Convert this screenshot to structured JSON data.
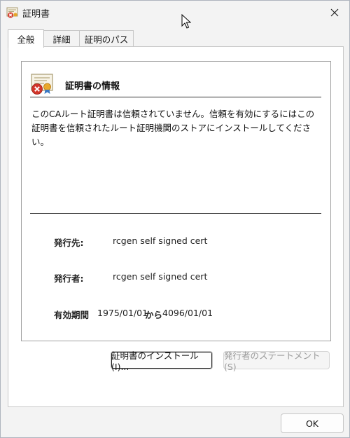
{
  "window": {
    "title": "証明書"
  },
  "tabs": [
    {
      "label": "全般"
    },
    {
      "label": "詳細"
    },
    {
      "label": "証明のパス"
    }
  ],
  "panel": {
    "heading": "証明書の情報",
    "message": "このCAルート証明書は信頼されていません。信頼を有効にするにはこの証明書を信頼されたルート証明機関のストアにインストールしてください。",
    "issued_to_label": "発行先:",
    "issued_to_value": "rcgen self signed cert",
    "issued_by_label": "発行者:",
    "issued_by_value": "rcgen self signed cert",
    "validity_label": "有効期間",
    "valid_from": "1975/01/01",
    "valid_sep": "から",
    "valid_to": "4096/01/01"
  },
  "buttons": {
    "install": "証明書のインストール(I)...",
    "issuer_statement": "発行者のステートメント(S)",
    "ok": "OK"
  },
  "icons": {
    "title": "certificate-icon",
    "panel": "certificate-untrusted-icon",
    "close": "close-icon",
    "cursor": "mouse-cursor-icon"
  }
}
